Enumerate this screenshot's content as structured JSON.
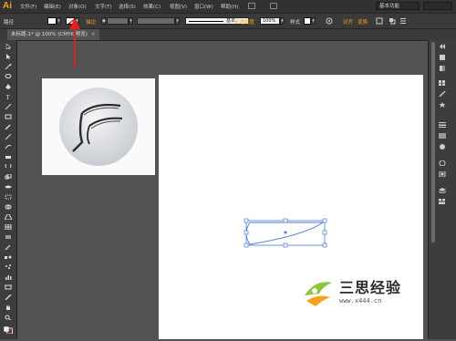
{
  "app": {
    "logo": "Ai"
  },
  "menu": [
    {
      "label": "文件(F)"
    },
    {
      "label": "编辑(E)"
    },
    {
      "label": "对象(O)"
    },
    {
      "label": "文字(T)"
    },
    {
      "label": "选择(S)"
    },
    {
      "label": "效果(C)"
    },
    {
      "label": "视图(V)"
    },
    {
      "label": "窗口(W)"
    },
    {
      "label": "帮助(H)"
    }
  ],
  "workspace": {
    "label": "基本功能"
  },
  "control": {
    "path_label": "路径",
    "stroke_label": "描边",
    "stroke_style_label": "基本",
    "opacity_label": "不透明度",
    "opacity_value": "100%",
    "style_label": "样式",
    "align_label": "对齐",
    "transform_label": "变换"
  },
  "document": {
    "tab_label": "未标题-1* @ 100% (CMYK/预览)",
    "close": "×"
  },
  "watermark": {
    "title": "三思经验",
    "url": "www.x444.cn"
  },
  "colors": {
    "accent": "#f7a21b",
    "arrow": "#e02020",
    "selection": "#4a78d8",
    "panel": "#3a3a3a",
    "canvas": "#535353"
  }
}
